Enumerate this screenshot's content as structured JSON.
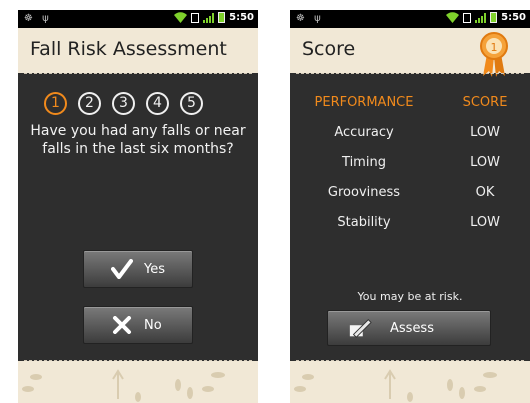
{
  "screens": [
    {
      "status": {
        "time": "5:50"
      },
      "title": "Fall Risk Assessment",
      "steps": [
        "1",
        "2",
        "3",
        "4",
        "5"
      ],
      "active_step": "1",
      "question": "Have you had any falls or near falls in the last six months?",
      "buttons": {
        "yes": "Yes",
        "no": "No"
      }
    },
    {
      "status": {
        "time": "5:50"
      },
      "title": "Score",
      "table": {
        "headers": [
          "PERFORMANCE",
          "SCORE"
        ],
        "rows": [
          [
            "Accuracy",
            "LOW"
          ],
          [
            "Timing",
            "LOW"
          ],
          [
            "Grooviness",
            "OK"
          ],
          [
            "Stability",
            "LOW"
          ]
        ]
      },
      "message": "You may be at risk.",
      "assess_label": "Assess",
      "badge_number": "1"
    }
  ],
  "colors": {
    "accent": "#f18a1c",
    "titlebar": "#f1e8d6",
    "body": "#2e2e2e"
  },
  "icons": [
    "wifi-icon",
    "signal-icon",
    "battery-icon",
    "check-icon",
    "x-icon",
    "pencil-icon",
    "award-ribbon-icon",
    "footprints-icon"
  ]
}
